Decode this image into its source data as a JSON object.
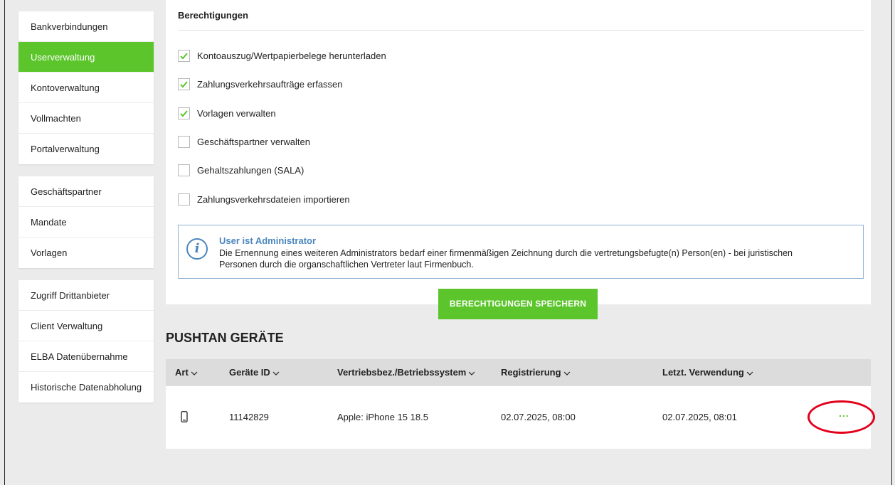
{
  "sidebar": {
    "group1": [
      {
        "label": "Bankverbindungen",
        "active": false
      },
      {
        "label": "Userverwaltung",
        "active": true
      },
      {
        "label": "Kontoverwaltung",
        "active": false
      },
      {
        "label": "Vollmachten",
        "active": false
      },
      {
        "label": "Portalverwaltung",
        "active": false
      }
    ],
    "group2": [
      {
        "label": "Geschäftspartner"
      },
      {
        "label": "Mandate"
      },
      {
        "label": "Vorlagen"
      }
    ],
    "group3": [
      {
        "label": "Zugriff Drittanbieter"
      },
      {
        "label": "Client Verwaltung"
      },
      {
        "label": "ELBA Datenübernahme"
      },
      {
        "label": "Historische Datenabholung"
      }
    ]
  },
  "permissions": {
    "title": "Berechtigungen",
    "items": [
      {
        "label": "Kontoauszug/Wertpapierbelege herunterladen",
        "checked": true
      },
      {
        "label": "Zahlungsverkehrsaufträge erfassen",
        "checked": true
      },
      {
        "label": "Vorlagen verwalten",
        "checked": true
      },
      {
        "label": "Geschäftspartner verwalten",
        "checked": false
      },
      {
        "label": "Gehaltszahlungen (SALA)",
        "checked": false
      },
      {
        "label": "Zahlungsverkehrsdateien importieren",
        "checked": false
      }
    ],
    "info": {
      "icon": "info-icon",
      "title": "User ist Administrator",
      "text": "Die Ernennung eines weiteren Administrators bedarf einer firmenmäßigen Zeichnung durch die vertretungsbefugte(n) Person(en) - bei juristischen Personen durch die organschaftlichen Vertreter laut Firmenbuch."
    },
    "save_label": "BERECHTIGUNGEN SPEICHERN"
  },
  "pushtan": {
    "title": "PUSHTAN GERÄTE",
    "columns": [
      "Art",
      "Geräte ID",
      "Vertriebsbez./Betriebssystem",
      "Registrierung",
      "Letzt. Verwendung"
    ],
    "rows": [
      {
        "art_icon": "smartphone-icon",
        "geraete_id": "11142829",
        "system": "Apple: iPhone 15 18.5",
        "registrierung": "02.07.2025, 08:00",
        "letzte_verwendung": "02.07.2025, 08:01",
        "actions": "..."
      }
    ]
  },
  "colors": {
    "accent_green": "#5bc52b",
    "info_blue": "#4a86be",
    "highlight_red": "#e3001b"
  }
}
